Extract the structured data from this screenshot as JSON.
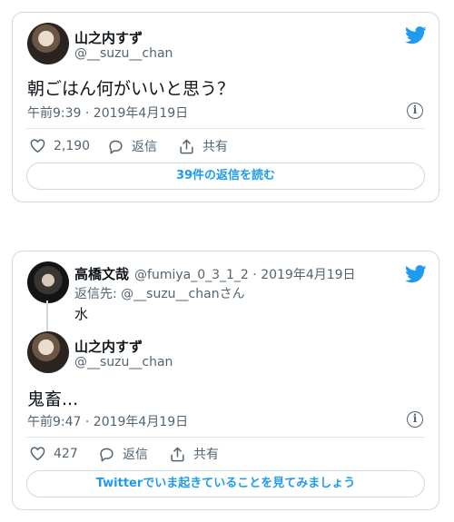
{
  "colors": {
    "accent": "#1d9bf0",
    "muted": "#536471",
    "text": "#0f1419",
    "border": "#cfd9de"
  },
  "icons": {
    "bird": "twitter-bird-icon",
    "like": "heart-icon",
    "reply": "reply-bubble-icon",
    "share": "share-icon",
    "info": "info-icon"
  },
  "tweet1": {
    "author_name": "山之内すず",
    "author_handle": "@__suzu__chan",
    "text": "朝ごはん何がいいと思う？",
    "timestamp": "午前9:39 · 2019年4月19日",
    "likes": "2,190",
    "reply_label": "返信",
    "share_label": "共有",
    "read_replies": "39件の返信を読む"
  },
  "tweet2": {
    "parent": {
      "author_name": "高橋文哉",
      "author_handle_date": "@fumiya_0_3_1_2 · 2019年4月19日",
      "reply_to": "返信先: @__suzu__chanさん",
      "text": "水"
    },
    "author_name": "山之内すず",
    "author_handle": "@__suzu__chan",
    "text": "鬼畜...",
    "timestamp": "午前9:47 · 2019年4月19日",
    "likes": "427",
    "reply_label": "返信",
    "share_label": "共有",
    "cta": "Twitterでいま起きていることを見てみましょう"
  }
}
